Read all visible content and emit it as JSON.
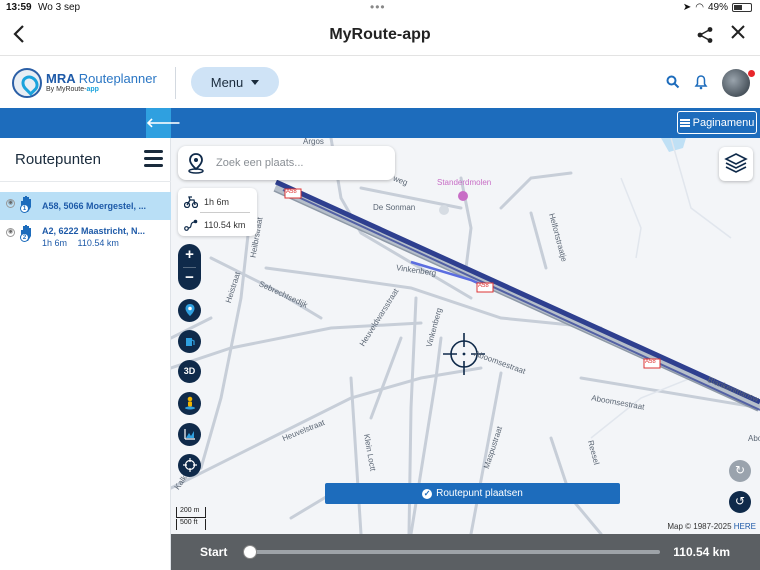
{
  "status_bar": {
    "time": "13:59",
    "date": "Wo 3 sep",
    "battery": "49%"
  },
  "title_bar": {
    "title": "MyRoute-app"
  },
  "header": {
    "logo_mra": "MRA",
    "logo_name": "Routeplanner",
    "logo_sub_prefix": "By MyRoute-",
    "logo_sub_suffix": "app",
    "menu_label": "Menu"
  },
  "toolbar": {
    "page_menu_label": "Paginamenu"
  },
  "route_panel": {
    "title": "Routepunten",
    "items": [
      {
        "badge": "1",
        "name": "A58, 5066 Moergestel, ...",
        "duration": "",
        "distance": "",
        "selected": true
      },
      {
        "badge": "2",
        "name": "A2, 6222 Maastricht, N...",
        "duration": "1h 6m",
        "distance": "110.54 km",
        "selected": false
      }
    ]
  },
  "map": {
    "search_placeholder": "Zoek een plaats...",
    "stats": {
      "duration": "1h 6m",
      "distance": "110.54 km"
    },
    "controls": {
      "zoom_in": "+",
      "zoom_out": "−",
      "three_d": "3D"
    },
    "place_button_label": "Routepunt plaatsen",
    "scale_m": "200 m",
    "scale_ft": "500 ft",
    "copyright_prefix": "Map © 1987-2025",
    "copyright_brand": "HERE",
    "labels": {
      "argos": "Argos",
      "de_sonman": "De Sonman",
      "standerdmolen": "Standerdmolen",
      "weg": "weg",
      "heiligstraat": "Heilbrstraat",
      "vinkenberg1": "Vinkenberg",
      "vinkenberg2": "Vinkenberg",
      "sebrechtsedijk": "Sebrechtsedijk",
      "heistraat": "Heistraat",
      "heuveldwarsstraat": "Heuveldwarsstraat",
      "heuvelstraat": "Heuvelstraat",
      "aboomsestraat1": "Aboomsestraat",
      "aboomsestraat2": "Aboomsestraat",
      "klein_loctt": "Klein Loctt",
      "maspustraat": "Maspustraat",
      "blankenmansw": "Blankenmansw",
      "abo": "Abo",
      "reesel": "Reesel",
      "helfortstraatje": "Helfortstraatje",
      "kalk": "Kalk",
      "a58_1": "A58",
      "a58_2": "A58",
      "a58_3": "A58"
    }
  },
  "bottom_bar": {
    "start_label": "Start",
    "distance": "110.54 km",
    "progress": 0.0
  },
  "colors": {
    "primary": "#1d6cbc",
    "accent": "#2fa0e0",
    "dark_control": "#0f2a4a",
    "route_line": "#3b4a9a"
  }
}
